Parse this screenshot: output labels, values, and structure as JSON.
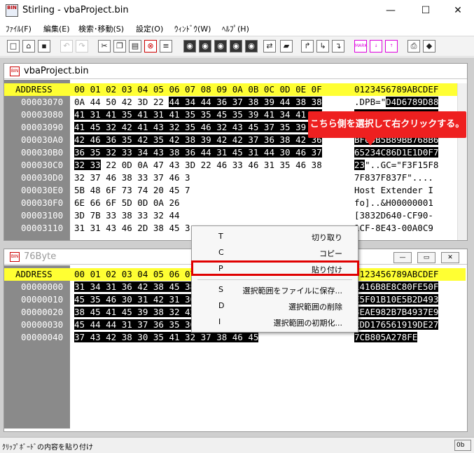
{
  "window": {
    "title": "Stirling - vbaProject.bin",
    "minimize": "—",
    "maximize": "☐",
    "close": "✕",
    "icon_text": "BIN"
  },
  "menu": [
    {
      "label": "ﾌｧｲﾙ(F)"
    },
    {
      "label": "編集(E)"
    },
    {
      "label": "検索･移動(S)"
    },
    {
      "label": "設定(O)"
    },
    {
      "label": "ｳｨﾝﾄﾞｳ(W)"
    },
    {
      "label": "ﾍﾙﾌﾟ(H)"
    }
  ],
  "callout": {
    "text": "こちら側を選択して右クリックする。",
    "color": "#ee2020"
  },
  "doc1": {
    "title": "vbaProject.bin",
    "header": {
      "address": "ADDRESS",
      "hex": "00 01 02 03 04 05 06 07 08 09 0A 0B 0C 0D 0E 0F",
      "ascii": "0123456789ABCDEF"
    },
    "rows": [
      {
        "addr": "00003070",
        "h1": "0A 44 50 42 3D 22 ",
        "h2": "44 34 44 36 37 38 39 44 38 38",
        "h3": "",
        "a1": ".DPB=\"",
        "a2": "D4D6789D88",
        "a3": ""
      },
      {
        "addr": "00003080",
        "h1": "",
        "h2": "41 31 41 35 41 31 41 35 35 45 35 39 41 34 41 37",
        "h3": "",
        "a1": "",
        "a2": "A1A5A1A55E59A4A7",
        "a3": ""
      },
      {
        "addr": "00003090",
        "h1": "",
        "h2": "41 45 32 42 41 43 32 35 46 32 43 45 37 35 39 38",
        "h3": "",
        "a1": "",
        "a2": "AE2BAC25F2CE7598",
        "a3": ""
      },
      {
        "addr": "000030A0",
        "h1": "",
        "h2": "42 46 36 35 42 35 42 38 39 42 42 37 36 38 42 36",
        "h3": "",
        "a1": "",
        "a2": "BF65B5B89BB768B6",
        "a3": ""
      },
      {
        "addr": "000030B0",
        "h1": "",
        "h2": "36 35 32 33 34 43 38 36 44 31 45 31 44 30 46 37",
        "h3": "",
        "a1": "",
        "a2": "65234C86D1E1D0F7",
        "a3": ""
      },
      {
        "addr": "000030C0",
        "h1": "",
        "h2": "32 33",
        "h3": " 22 0D 0A 47 43 3D 22 46 33 46 31 35 46 38",
        "a1": "",
        "a2": "23",
        "a3": "\"..GC=\"F3F15F8"
      },
      {
        "addr": "000030D0",
        "h1": "32 37 46 38 33 37 46 3",
        "h2": "",
        "h3": "",
        "a1": "7F837F837F\"....",
        "a2": "",
        "a3": ""
      },
      {
        "addr": "000030E0",
        "h1": "5B 48 6F 73 74 20 45 7",
        "h2": "",
        "h3": "",
        "a1": "Host Extender I",
        "a2": "",
        "a3": ""
      },
      {
        "addr": "000030F0",
        "h1": "6E 66 6F 5D 0D 0A 26",
        "h2": "",
        "h3": "",
        "a1": "fo]..&H00000001",
        "a2": "",
        "a3": ""
      },
      {
        "addr": "00003100",
        "h1": "3D 7B 33 38 33 32 44",
        "h2": "",
        "h3": "",
        "a1": "[3832D640-CF90-",
        "a2": "",
        "a3": ""
      },
      {
        "addr": "00003110",
        "h1": "31 31 43 46 2D 38 45 3",
        "h2": "",
        "h3": "",
        "a1": "1CF-8E43-00A0C9",
        "a2": "",
        "a3": ""
      }
    ]
  },
  "doc2": {
    "title": "76Byte",
    "header": {
      "address": "ADDRESS",
      "hex": "00 01 02 03 04 05 06 07 08 09 0A 0B 0C 0D 0E 0F",
      "ascii": "0123456789ABCDEF"
    },
    "rows": [
      {
        "addr": "00000000",
        "h2": "31 34 31 36 42 38 45 38 43 38 30 46 45 35 30 46",
        "a2": "1416B8E8C80FE50F"
      },
      {
        "addr": "00000010",
        "h2": "45 35 46 30 31 42 31 30 45 35 42 32 44 34 39 33",
        "a2": "E5F01B10E5B2D493"
      },
      {
        "addr": "00000020",
        "h2": "38 45 41 45 39 38 32 42 37 42 34 39 33 37 45 39",
        "a2": "8EAE982B7B4937E9"
      },
      {
        "addr": "00000030",
        "h2": "45 44 44 31 37 36 35 36 31 39 31 39 44 45 32 37",
        "a2": "EDD176561919DE27"
      },
      {
        "addr": "00000040",
        "h2": "37 43 42 38 30 35 41 32 37 38 46 45",
        "a2": "7CB805A278FE"
      }
    ]
  },
  "context_menu": [
    {
      "key": "T",
      "label": "切り取り"
    },
    {
      "key": "C",
      "label": "コピー"
    },
    {
      "key": "P",
      "label": "貼り付け"
    },
    {
      "key": "S",
      "label": "選択範囲をファイルに保存..."
    },
    {
      "key": "D",
      "label": "選択範囲の削除"
    },
    {
      "key": "I",
      "label": "選択範囲の初期化..."
    }
  ],
  "highlight_color": "#e00000",
  "status": {
    "text": "ｸﾘｯﾌﾟﾎﾞｰﾄﾞの内容を貼り付け",
    "right": "0b"
  }
}
